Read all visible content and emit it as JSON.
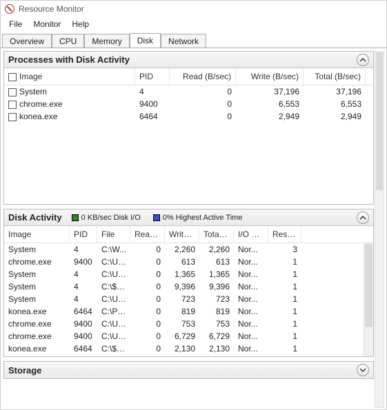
{
  "title": "Resource Monitor",
  "menu": {
    "file": "File",
    "monitor": "Monitor",
    "help": "Help"
  },
  "tabs": {
    "overview": "Overview",
    "cpu": "CPU",
    "memory": "Memory",
    "disk": "Disk",
    "network": "Network"
  },
  "panel1": {
    "title": "Processes with Disk Activity",
    "headers": {
      "image": "Image",
      "pid": "PID",
      "read": "Read (B/sec)",
      "write": "Write (B/sec)",
      "total": "Total (B/sec)"
    },
    "rows": [
      {
        "image": "System",
        "pid": "4",
        "read": "0",
        "write": "37,196",
        "total": "37,196"
      },
      {
        "image": "chrome.exe",
        "pid": "9400",
        "read": "0",
        "write": "6,553",
        "total": "6,553"
      },
      {
        "image": "konea.exe",
        "pid": "6464",
        "read": "0",
        "write": "2,949",
        "total": "2,949"
      }
    ]
  },
  "panel2": {
    "title": "Disk Activity",
    "legend1": "0 KB/sec Disk I/O",
    "legend2": "0% Highest Active Time",
    "headers": {
      "image": "Image",
      "pid": "PID",
      "file": "File",
      "read": "Read ...",
      "write": "Write...",
      "total": "Total ...",
      "iopr": "I/O Pr...",
      "resp": "Resp..."
    },
    "rows": [
      {
        "image": "System",
        "pid": "4",
        "file": "C:\\W...",
        "read": "0",
        "write": "2,260",
        "total": "2,260",
        "iopr": "Nor...",
        "resp": "3"
      },
      {
        "image": "chrome.exe",
        "pid": "9400",
        "file": "C:\\Us...",
        "read": "0",
        "write": "613",
        "total": "613",
        "iopr": "Nor...",
        "resp": "1"
      },
      {
        "image": "System",
        "pid": "4",
        "file": "C:\\Us...",
        "read": "0",
        "write": "1,365",
        "total": "1,365",
        "iopr": "Nor...",
        "resp": "1"
      },
      {
        "image": "System",
        "pid": "4",
        "file": "C:\\$L...",
        "read": "0",
        "write": "9,396",
        "total": "9,396",
        "iopr": "Nor...",
        "resp": "1"
      },
      {
        "image": "System",
        "pid": "4",
        "file": "C:\\Us...",
        "read": "0",
        "write": "723",
        "total": "723",
        "iopr": "Nor...",
        "resp": "1"
      },
      {
        "image": "konea.exe",
        "pid": "6464",
        "file": "C:\\Pr...",
        "read": "0",
        "write": "819",
        "total": "819",
        "iopr": "Nor...",
        "resp": "1"
      },
      {
        "image": "chrome.exe",
        "pid": "9400",
        "file": "C:\\Us...",
        "read": "0",
        "write": "753",
        "total": "753",
        "iopr": "Nor...",
        "resp": "1"
      },
      {
        "image": "chrome.exe",
        "pid": "9400",
        "file": "C:\\Us...",
        "read": "0",
        "write": "6,729",
        "total": "6,729",
        "iopr": "Nor...",
        "resp": "1"
      },
      {
        "image": "konea.exe",
        "pid": "6464",
        "file": "C:\\$L...",
        "read": "0",
        "write": "2,130",
        "total": "2,130",
        "iopr": "Nor...",
        "resp": "1"
      }
    ]
  },
  "panel3": {
    "title": "Storage"
  }
}
